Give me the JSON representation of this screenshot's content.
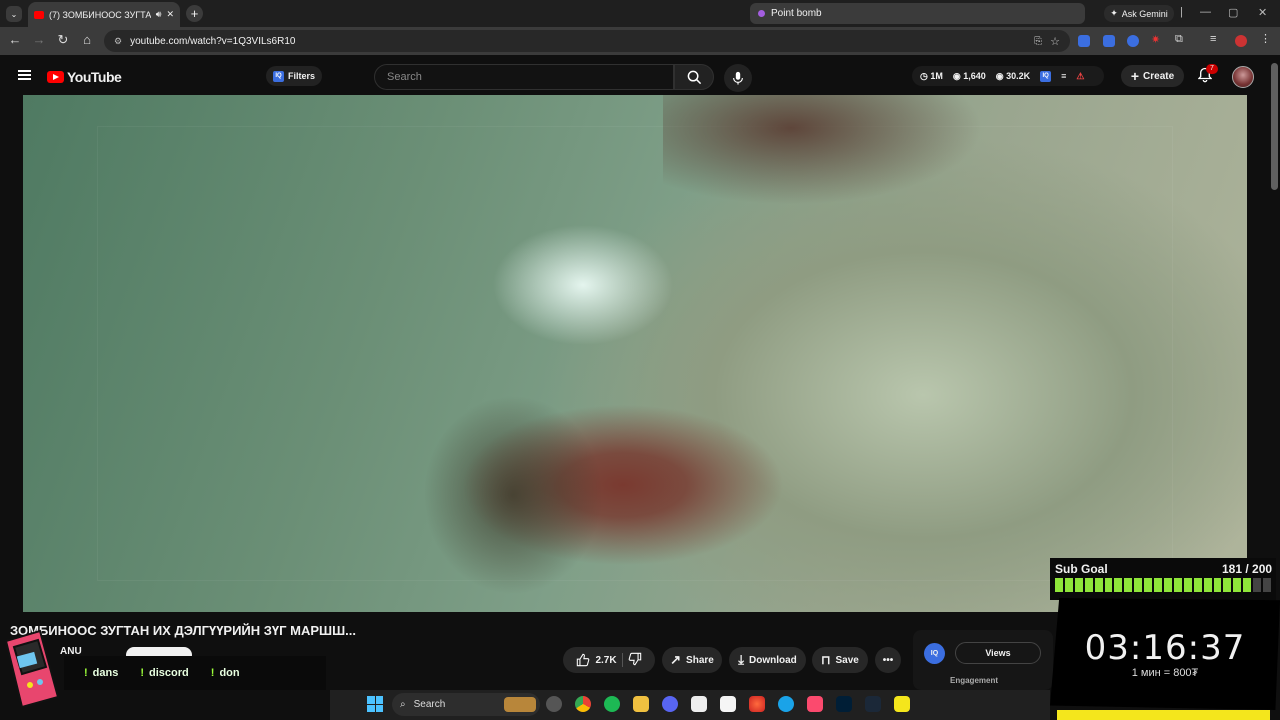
{
  "browser": {
    "active_tab_title": "(7) ЗОМБИНООС ЗУГТАН И",
    "other_tab_title": "Point bomb",
    "ask_gemini_label": "Ask Gemini",
    "url": "youtube.com/watch?v=1Q3VILs6R10"
  },
  "youtube": {
    "logo_text": "YouTube",
    "filters_label": "Filters",
    "iq_badge": "IQ",
    "search_placeholder": "Search",
    "stats": {
      "subs": "1M",
      "videos": "1,640",
      "views": "30.2K"
    },
    "create_label": "Create",
    "notification_count": "7"
  },
  "video": {
    "title": "ЗОМБИНООС ЗУГТАН ИХ ДЭЛГҮҮРИЙН ЗҮГ МАРШШ...",
    "channel": "ANU",
    "likes": "2.7K",
    "share_label": "Share",
    "download_label": "Download",
    "save_label": "Save",
    "more_label": "•••"
  },
  "iq_panel": {
    "logo": "IQ",
    "views_label": "Views",
    "engagement_label": "Engagement"
  },
  "stream_overlay": {
    "commands": [
      {
        "bang": "!",
        "label": "dans"
      },
      {
        "bang": "!",
        "label": "discord"
      },
      {
        "bang": "!",
        "label": "don"
      }
    ],
    "sub_goal_label": "Sub Goal",
    "sub_goal_count": "181 / 200",
    "sub_goal_progress": 0.905,
    "timer": "03:16:37",
    "timer_rate": "1 мин = 800₮"
  },
  "taskbar": {
    "search_label": "Search"
  },
  "colors": {
    "youtube_red": "#ff0000",
    "subgoal_green": "#8fe63a",
    "timer_yellow": "#f4e61c",
    "iq_blue": "#3b6ee0"
  }
}
